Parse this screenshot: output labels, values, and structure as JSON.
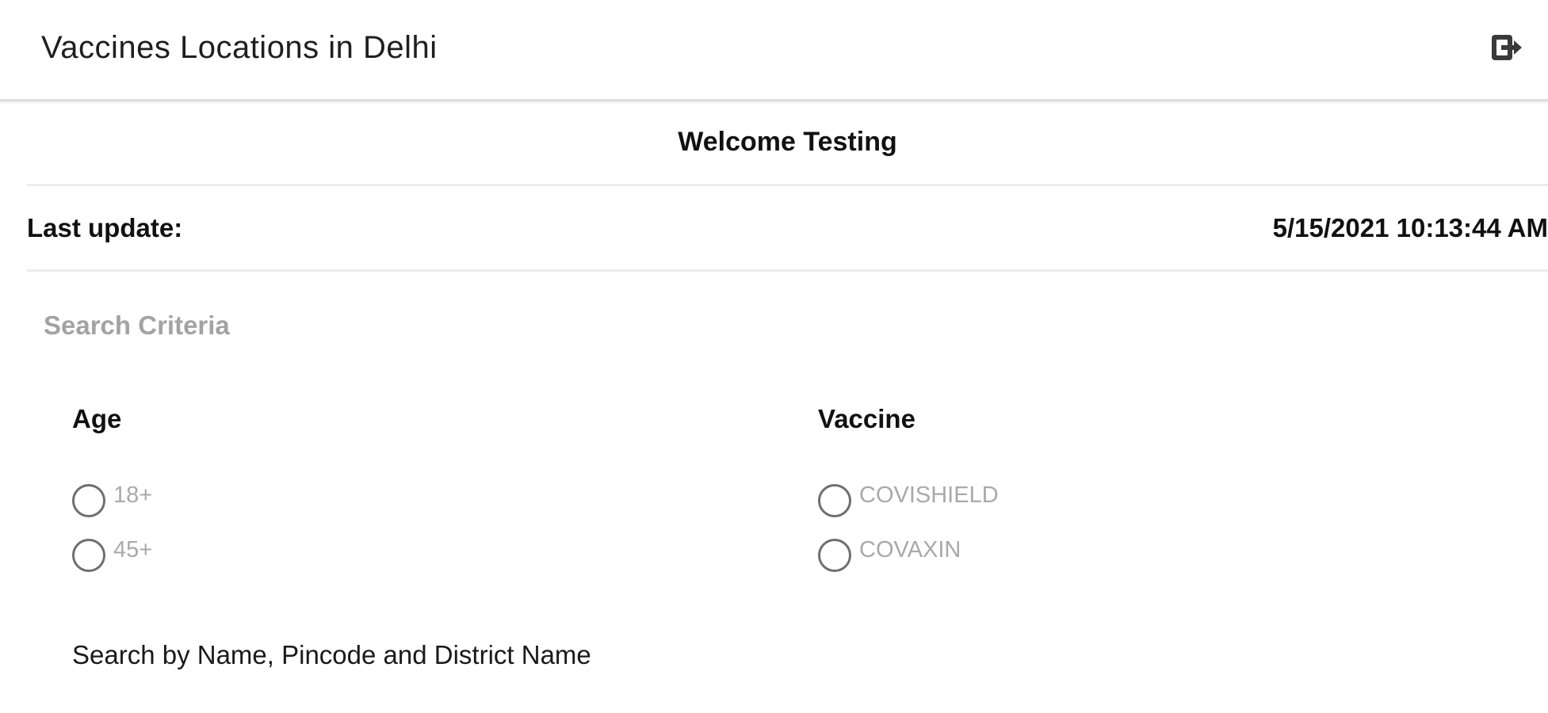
{
  "header": {
    "title": "Vaccines Locations in Delhi",
    "logout_icon": "logout-icon"
  },
  "welcome": {
    "text": "Welcome Testing"
  },
  "last_update": {
    "label": "Last update:",
    "value": "5/15/2021 10:13:44 AM"
  },
  "search_criteria": {
    "title": "Search Criteria",
    "age": {
      "label": "Age",
      "options": [
        {
          "label": "18+",
          "selected": false
        },
        {
          "label": "45+",
          "selected": false
        }
      ]
    },
    "vaccine": {
      "label": "Vaccine",
      "options": [
        {
          "label": "COVISHIELD",
          "selected": false
        },
        {
          "label": "COVAXIN",
          "selected": false
        }
      ]
    },
    "search_label": "Search by Name, Pincode and District Name"
  },
  "colors": {
    "muted_text": "#a3a3a3",
    "radio_border": "#6f6f6f",
    "divider": "#ececec"
  }
}
